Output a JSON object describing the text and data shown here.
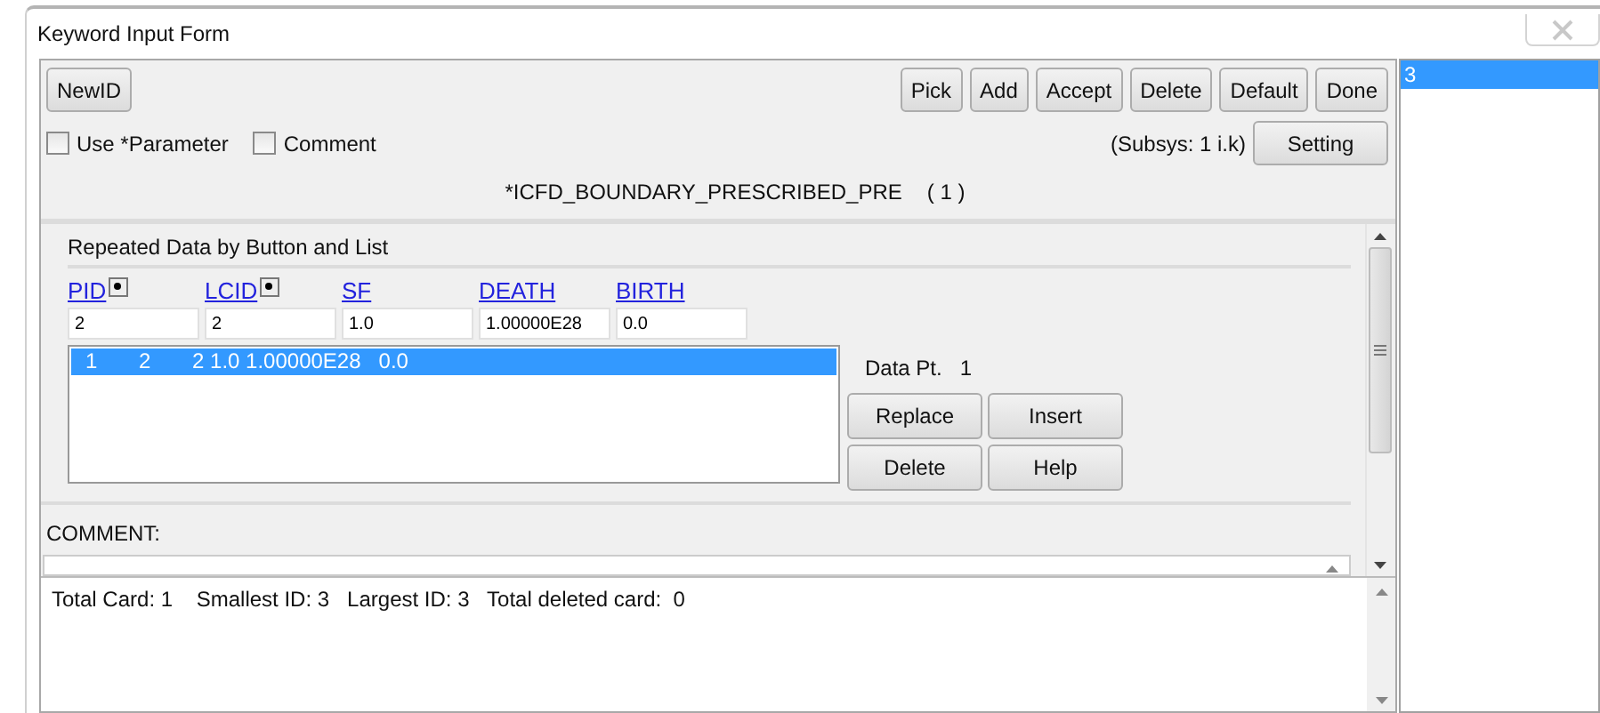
{
  "window": {
    "title": "Keyword Input Form"
  },
  "left_buttons": [
    "NewID"
  ],
  "top_buttons": [
    "Pick",
    "Add",
    "Accept",
    "Delete",
    "Default",
    "Done"
  ],
  "options": [
    {
      "label": "Use *Parameter",
      "checked": false
    },
    {
      "label": "Comment",
      "checked": false
    }
  ],
  "subsys": "(Subsys: 1 i.k)",
  "setting_button": "Setting",
  "keyword": "*ICFD_BOUNDARY_PRESCRIBED_PRE",
  "keyword_count": "( 1 )",
  "group_title": "Repeated Data by Button and List",
  "fields": [
    {
      "label": "PID",
      "kind": "picker",
      "value": "2"
    },
    {
      "label": "LCID",
      "kind": "picker",
      "value": "2"
    },
    {
      "label": "SF",
      "kind": "plain",
      "value": "1.0"
    },
    {
      "label": "DEATH",
      "kind": "plain",
      "value": "1.00000E28"
    },
    {
      "label": "BIRTH",
      "kind": "plain",
      "value": "0.0"
    }
  ],
  "data_rows": [
    {
      "text": "1       2       2 1.0 1.00000E28   0.0",
      "selected": true
    }
  ],
  "data_pt_label": "Data Pt.",
  "data_pt_value": "1",
  "row_buttons": [
    "Replace",
    "Insert",
    "Delete",
    "Help"
  ],
  "comment_label": "COMMENT:",
  "output": "Total Card: 1    Smallest ID: 3   Largest ID: 3   Total deleted card:  0",
  "id_list": [
    {
      "label": "3",
      "selected": true
    }
  ]
}
